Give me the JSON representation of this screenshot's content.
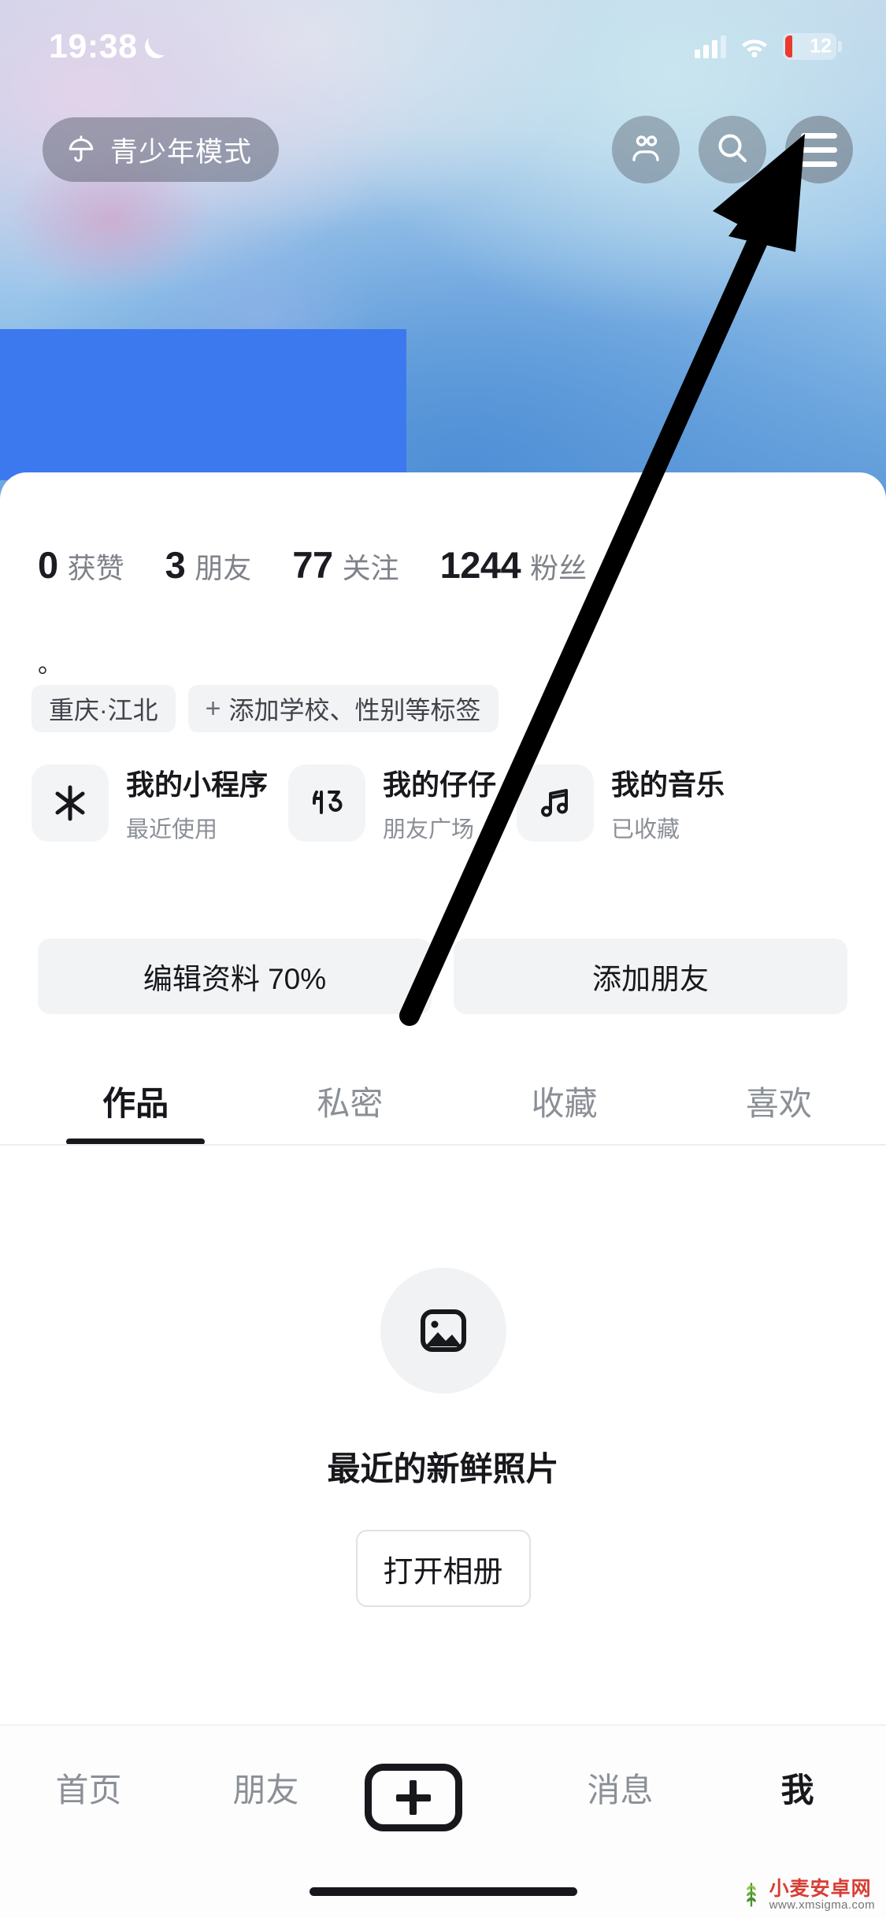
{
  "status_bar": {
    "time": "19:38",
    "moon_icon": "crescent-moon-icon",
    "signal_icon": "cellular-signal-icon",
    "wifi_icon": "wifi-icon",
    "battery_level": "12"
  },
  "header": {
    "teen_mode_label": "青少年模式",
    "teen_mode_icon": "umbrella-icon",
    "friends_icon": "two-people-icon",
    "search_icon": "search-icon",
    "menu_icon": "hamburger-menu-icon"
  },
  "profile": {
    "stats": [
      {
        "value": "0",
        "label": "获赞"
      },
      {
        "value": "3",
        "label": "朋友"
      },
      {
        "value": "77",
        "label": "关注"
      },
      {
        "value": "1244",
        "label": "粉丝"
      }
    ],
    "bio": "。",
    "tags": [
      {
        "label": "重庆·江北",
        "has_plus": false
      },
      {
        "label": "添加学校、性别等标签",
        "has_plus": true,
        "plus": "+"
      }
    ],
    "apps": [
      {
        "icon": "snowflake-icon",
        "title": "我的小程序",
        "subtitle": "最近使用"
      },
      {
        "icon": "zai-character-icon",
        "title": "我的仔仔",
        "subtitle": "朋友广场"
      },
      {
        "icon": "music-note-icon",
        "title": "我的音乐",
        "subtitle": "已收藏"
      }
    ],
    "actions": [
      {
        "label": "编辑资料 70%"
      },
      {
        "label": "添加朋友"
      }
    ]
  },
  "tabs": [
    {
      "label": "作品",
      "active": true
    },
    {
      "label": "私密",
      "active": false
    },
    {
      "label": "收藏",
      "active": false
    },
    {
      "label": "喜欢",
      "active": false
    }
  ],
  "empty_state": {
    "icon": "image-placeholder-icon",
    "text": "最近的新鲜照片",
    "button_label": "打开相册"
  },
  "bottom_nav": [
    {
      "label": "首页",
      "active": false
    },
    {
      "label": "朋友",
      "active": false
    },
    {
      "label": "+",
      "active": false,
      "is_plus": true
    },
    {
      "label": "消息",
      "active": false
    },
    {
      "label": "我",
      "active": true
    }
  ],
  "watermark": {
    "title": "小麦安卓网",
    "url": "www.xmsigma.com",
    "icon": "wheat-icon"
  },
  "colors": {
    "accent_blue": "#3c79ef",
    "battery_red": "#ea3b2e",
    "text_primary": "#17171c",
    "text_muted": "#8b8f96",
    "chip_bg": "#f2f3f5"
  }
}
